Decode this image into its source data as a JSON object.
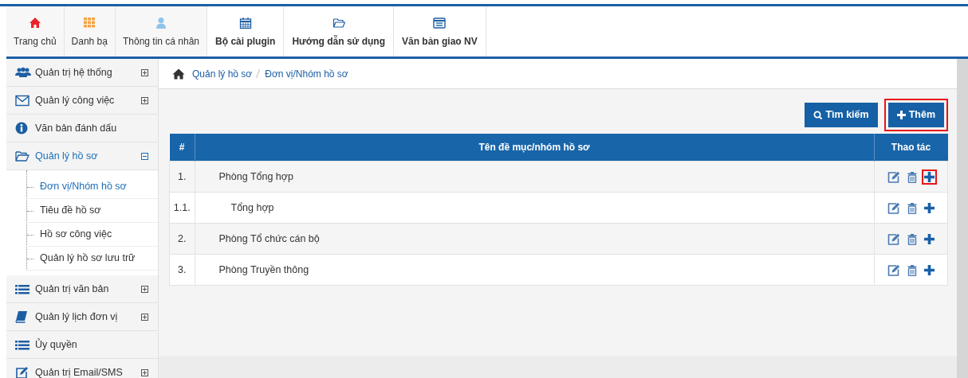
{
  "nav": [
    {
      "label": "Trang chủ",
      "bold": false
    },
    {
      "label": "Danh bạ",
      "bold": false
    },
    {
      "label": "Thông tin cá nhân",
      "bold": false
    },
    {
      "label": "Bộ cài plugin",
      "bold": true
    },
    {
      "label": "Hướng dẫn sử dụng",
      "bold": true
    },
    {
      "label": "Văn bản giao NV",
      "bold": true
    }
  ],
  "sidebar": {
    "items": [
      {
        "label": "Quản trị hệ thống",
        "expanded": false,
        "selected": false
      },
      {
        "label": "Quản lý công việc",
        "expanded": false,
        "selected": false
      },
      {
        "label": "Văn bản đánh dấu",
        "selected": false
      },
      {
        "label": "Quản lý hồ sơ",
        "expanded": true,
        "selected": true,
        "children": [
          {
            "label": "Đơn vị/Nhóm hồ sơ",
            "selected": true
          },
          {
            "label": "Tiêu đề hồ sơ",
            "selected": false
          },
          {
            "label": "Hồ sơ công việc",
            "selected": false
          },
          {
            "label": "Quản lý hồ sơ lưu trữ",
            "selected": false
          }
        ]
      },
      {
        "label": "Quản trị văn bản",
        "expanded": false,
        "selected": false
      },
      {
        "label": "Quản lý lịch đơn vị",
        "expanded": false,
        "selected": false
      },
      {
        "label": "Ủy quyền",
        "selected": false
      },
      {
        "label": "Quản trị Email/SMS",
        "expanded": false,
        "selected": false
      }
    ]
  },
  "breadcrumb": [
    "Quản lý hồ sơ",
    "Đơn vị/Nhóm hồ sơ"
  ],
  "buttons": [
    {
      "label": "Tìm kiếm",
      "kind": "search"
    },
    {
      "label": "Thêm",
      "kind": "add",
      "highlighted": true
    }
  ],
  "table": {
    "columns": [
      "#",
      "Tên đề mục/nhóm hồ sơ",
      "Thao tác"
    ],
    "rows": [
      {
        "number": "1.",
        "name": "Phòng Tổng hợp",
        "add_highlighted": true,
        "children": [
          {
            "number": "1.1.",
            "name": "Tổng hợp",
            "add_highlighted": false
          }
        ]
      },
      {
        "number": "2.",
        "name": "Phòng Tổ chức cán bộ",
        "add_highlighted": false
      },
      {
        "number": "3.",
        "name": "Phòng Truyền thông",
        "add_highlighted": false
      }
    ]
  }
}
